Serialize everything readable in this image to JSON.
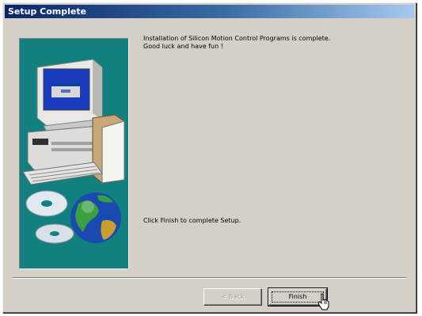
{
  "window": {
    "title": "Setup Complete"
  },
  "content": {
    "message_line1": "Installation of Silicon Motion Control Programs is complete.",
    "message_line2": "Good luck and have fun !",
    "instruction": "Click Finish to complete Setup."
  },
  "buttons": {
    "back_label": "< Back",
    "back_enabled": false,
    "finish_label": "Finish"
  },
  "icons": {
    "illustration": "computer-and-disc-illustration",
    "cursor": "hand-pointer-icon"
  },
  "colors": {
    "titlebar": "#0a246a",
    "panel_bg": "#138080",
    "dialog_bg": "#d4d0c8"
  }
}
